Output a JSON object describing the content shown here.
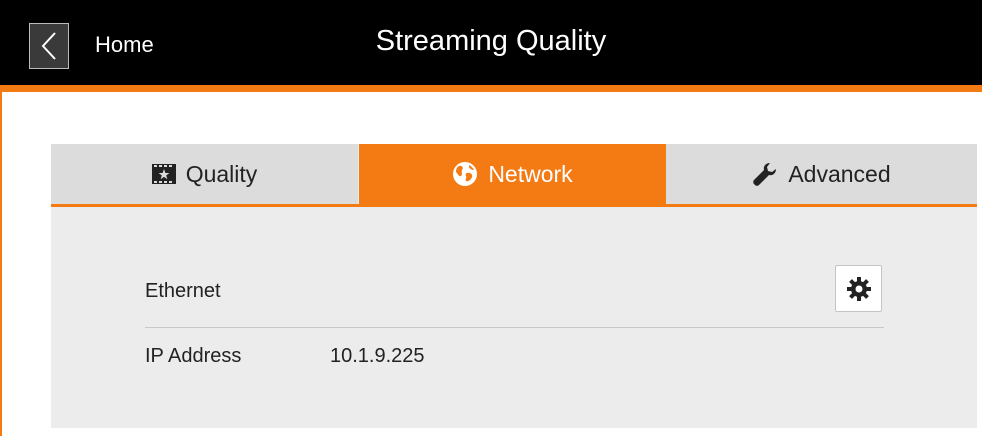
{
  "header": {
    "back_label": "Home",
    "title": "Streaming Quality"
  },
  "tabs": [
    {
      "label": "Quality",
      "icon": "film-star-icon",
      "selected": false
    },
    {
      "label": "Network",
      "icon": "globe-icon",
      "selected": true
    },
    {
      "label": "Advanced",
      "icon": "wrench-icon",
      "selected": false
    }
  ],
  "network": {
    "connection_label": "Ethernet",
    "settings_icon": "gear-icon",
    "ip_label": "IP Address",
    "ip_value": "10.1.9.225"
  },
  "colors": {
    "accent": "#f47a14",
    "header_bg": "#000000",
    "panel_bg": "#ececec",
    "tab_bg": "#dcdcdc"
  }
}
